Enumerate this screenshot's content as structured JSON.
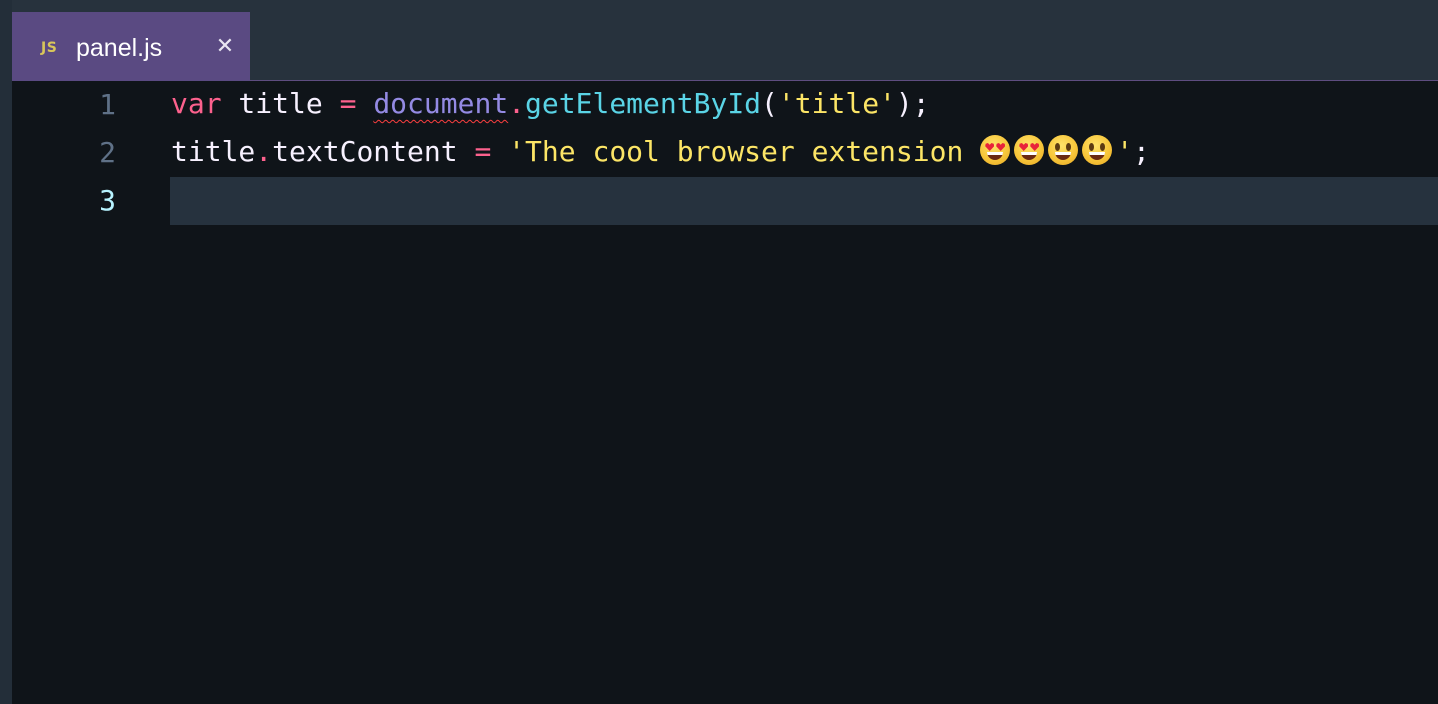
{
  "tab": {
    "icon_label": "JS",
    "title": "panel.js",
    "close_glyph": "✕"
  },
  "editor": {
    "lines": [
      {
        "number": "1",
        "tokens": {
          "t1": "var",
          "t2": " title ",
          "t3": "=",
          "t4": " ",
          "t5": "document",
          "t6": ".",
          "t7": "getElementById",
          "t8": "(",
          "t9": "'title'",
          "t10": ");"
        }
      },
      {
        "number": "2",
        "tokens": {
          "t1": "title",
          "t2": ".",
          "t3": "textContent",
          "t4": " ",
          "t5": "=",
          "t6": " ",
          "t7": "'The cool browser extension ",
          "t8": "'",
          "t9": ";"
        },
        "emojis": [
          "heart-eyes-emoji",
          "heart-eyes-emoji",
          "grinning-emoji",
          "grinning-emoji"
        ]
      },
      {
        "number": "3",
        "tokens": {}
      }
    ],
    "current_line": 3
  },
  "colors": {
    "keyword": "#fc618d",
    "function": "#5ad4e6",
    "string": "#fce566",
    "object": "#948ae3",
    "tab_active_bg": "#5a4a82",
    "editor_bg": "#0f1419"
  }
}
